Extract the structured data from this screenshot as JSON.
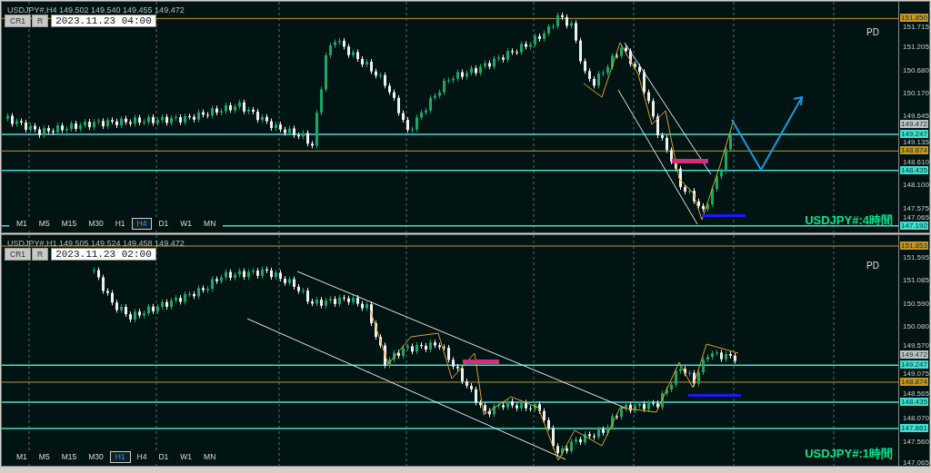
{
  "panels": [
    {
      "header": "USDJPY#,H4  149.502 149.540 149.455 149.472",
      "buttons": [
        "CR1",
        "R"
      ],
      "date": "2023.11.23 04:00",
      "marker": "PD",
      "label": "USDJPY#:4時間",
      "axis_ticks": [
        "151.715",
        "151.205",
        "150.680",
        "150.170",
        "149.645",
        "149.135",
        "148.610",
        "148.100",
        "147.575",
        "147.065"
      ],
      "levels": [
        {
          "price": "151.850",
          "color": "#c8961e",
          "kind": "line"
        },
        {
          "price": "149.472",
          "color": "#c0c0c0",
          "kind": "tag"
        },
        {
          "price": "149.247",
          "color": "#40e0d0",
          "kind": "line"
        },
        {
          "price": "148.874",
          "color": "#c8961e",
          "kind": "line"
        },
        {
          "price": "148.435",
          "color": "#40e0d0",
          "kind": "line"
        },
        {
          "price": "147.192",
          "color": "#40e0d0",
          "kind": "line"
        }
      ],
      "timeframes": [
        {
          "label": "M1",
          "selected": false
        },
        {
          "label": "M5",
          "selected": false
        },
        {
          "label": "M15",
          "selected": false
        },
        {
          "label": "M30",
          "selected": false
        },
        {
          "label": "H1",
          "selected": false
        },
        {
          "label": "H4",
          "selected": true
        },
        {
          "label": "D1",
          "selected": false
        },
        {
          "label": "W1",
          "selected": false
        },
        {
          "label": "MN",
          "selected": false
        }
      ]
    },
    {
      "header": "USDJPY#,H1  149.505 149.524 149.458 149.472",
      "buttons": [
        "CR1",
        "R"
      ],
      "date": "2023.11.23 02:00",
      "marker": "PD",
      "label": "USDJPY#:1時間",
      "axis_ticks": [
        "151.595",
        "151.085",
        "150.590",
        "150.080",
        "149.570",
        "149.075",
        "148.565",
        "148.070",
        "147.560",
        "147.065"
      ],
      "levels": [
        {
          "price": "151.853",
          "color": "#c8961e",
          "kind": "line"
        },
        {
          "price": "149.472",
          "color": "#c0c0c0",
          "kind": "tag"
        },
        {
          "price": "149.247",
          "color": "#40e0d0",
          "kind": "line"
        },
        {
          "price": "148.874",
          "color": "#c8961e",
          "kind": "line"
        },
        {
          "price": "148.435",
          "color": "#40e0d0",
          "kind": "line"
        },
        {
          "price": "147.861",
          "color": "#40e0d0",
          "kind": "line"
        }
      ],
      "timeframes": [
        {
          "label": "M1",
          "selected": false
        },
        {
          "label": "M5",
          "selected": false
        },
        {
          "label": "M15",
          "selected": false
        },
        {
          "label": "M30",
          "selected": false
        },
        {
          "label": "H1",
          "selected": true
        },
        {
          "label": "H4",
          "selected": false
        },
        {
          "label": "D1",
          "selected": false
        },
        {
          "label": "W1",
          "selected": false
        },
        {
          "label": "MN",
          "selected": false
        }
      ]
    }
  ]
}
